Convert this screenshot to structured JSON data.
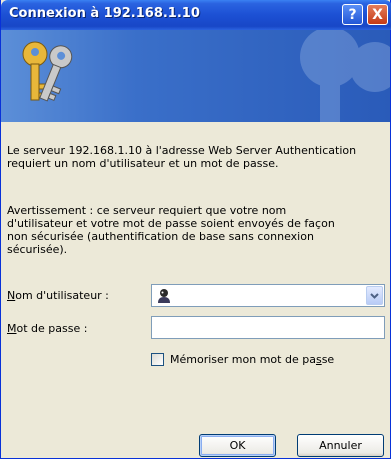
{
  "window": {
    "title": "Connexion à 192.168.1.10",
    "help_button": "?",
    "close_button": "X"
  },
  "message": {
    "line1": "Le serveur 192.168.1.10 à l'adresse Web Server Authentication requiert un nom d'utilisateur et un mot de passe.",
    "warning": "Avertissement : ce serveur requiert que votre nom d'utilisateur et votre mot de passe soient envoyés de façon non sécurisée (authentification de base sans connexion sécurisée)."
  },
  "form": {
    "username_label_first": "N",
    "username_label_rest": "om d'utilisateur :",
    "username_value": "",
    "password_label_first": "M",
    "password_label_rest": "ot de passe :",
    "password_value": "",
    "remember_label_a": "Mémoriser mon mot de pa",
    "remember_label_u": "s",
    "remember_label_b": "se",
    "remember_checked": false
  },
  "buttons": {
    "ok": "OK",
    "cancel": "Annuler"
  },
  "icons": {
    "banner": "keys-icon",
    "username": "user-icon",
    "dropdown": "chevron-down-icon"
  },
  "colors": {
    "titlebar": "#1c50d4",
    "banner": "#3a6fc9",
    "dialog_bg": "#ece9d8"
  }
}
